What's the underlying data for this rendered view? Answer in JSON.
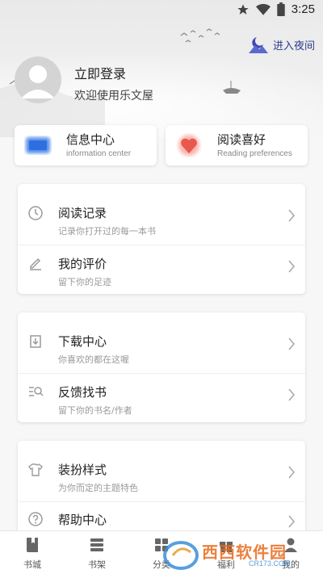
{
  "status_bar": {
    "time": "3:25",
    "icons": [
      "star-icon",
      "wifi-icon",
      "battery-icon"
    ]
  },
  "header": {
    "night_mode_label": "进入夜间",
    "login_title": "立即登录",
    "welcome_text": "欢迎使用乐文屋"
  },
  "quick_cards": [
    {
      "title": "信息中心",
      "subtitle": "information center",
      "icon": "message-icon",
      "color": "#2e6fe0"
    },
    {
      "title": "阅读喜好",
      "subtitle": "Reading preferences",
      "icon": "heart-icon",
      "color": "#e8584c"
    }
  ],
  "menu_groups": [
    [
      {
        "title": "阅读记录",
        "subtitle": "记录你打开过的每一本书",
        "icon": "clock-icon"
      },
      {
        "title": "我的评价",
        "subtitle": "留下你的足迹",
        "icon": "pen-icon"
      }
    ],
    [
      {
        "title": "下载中心",
        "subtitle": "你喜欢的都在这喔",
        "icon": "download-icon"
      },
      {
        "title": "反馈找书",
        "subtitle": "留下你的书名/作者",
        "icon": "search-list-icon"
      }
    ],
    [
      {
        "title": "装扮样式",
        "subtitle": "为你而定的主题特色",
        "icon": "shirt-icon"
      },
      {
        "title": "帮助中心",
        "subtitle": "",
        "icon": "help-icon"
      }
    ]
  ],
  "bottom_nav": [
    {
      "label": "书城",
      "icon": "book-icon"
    },
    {
      "label": "书架",
      "icon": "shelf-icon"
    },
    {
      "label": "分类",
      "icon": "category-icon"
    },
    {
      "label": "福利",
      "icon": "gift-icon"
    },
    {
      "label": "我的",
      "icon": "user-icon"
    }
  ],
  "watermark": {
    "text": "西西软件园",
    "sub": "CR173.COM"
  }
}
